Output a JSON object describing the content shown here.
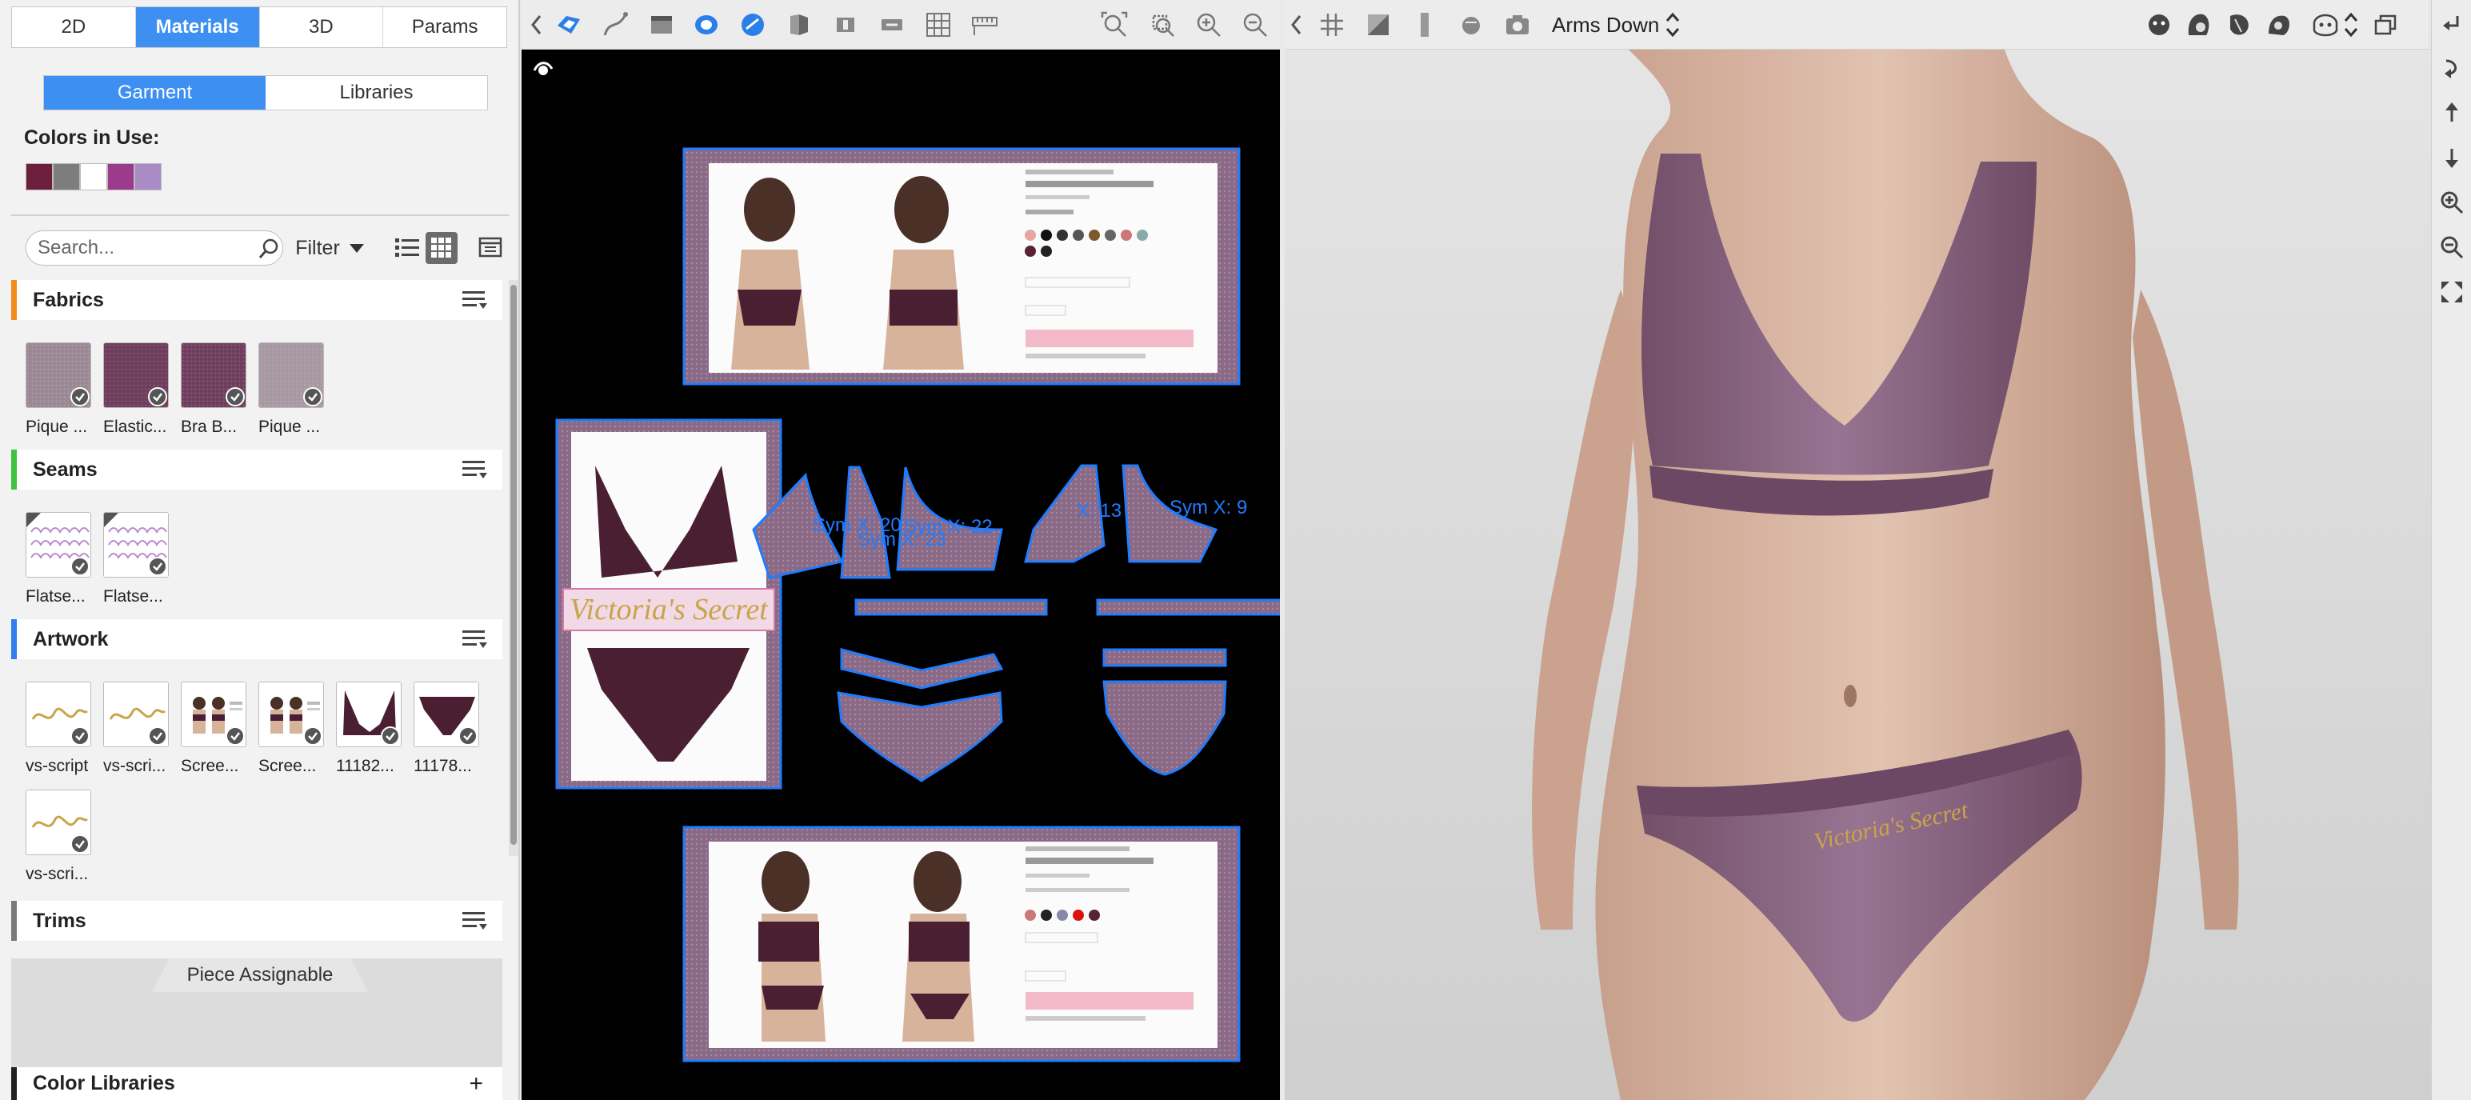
{
  "mode_tabs": [
    {
      "label": "2D",
      "active": false
    },
    {
      "label": "Materials",
      "active": true
    },
    {
      "label": "3D",
      "active": false
    },
    {
      "label": "Params",
      "active": false
    }
  ],
  "sub_tabs": [
    {
      "label": "Garment",
      "active": true
    },
    {
      "label": "Libraries",
      "active": false
    }
  ],
  "colors_in_use": {
    "title": "Colors in Use:",
    "swatches": [
      "#6b1f3d",
      "#7d7d7d",
      "#ffffff",
      "#9c3b8c",
      "#a98bc6"
    ]
  },
  "search": {
    "placeholder": "Search...",
    "value": ""
  },
  "filter": {
    "label": "Filter"
  },
  "sections": {
    "fabrics": {
      "title": "Fabrics",
      "accent": "#f28c1b",
      "items": [
        {
          "label": "Pique ...",
          "swatch": "#9a8994"
        },
        {
          "label": "Elastic...",
          "swatch": "#6e3e5c"
        },
        {
          "label": "Bra B...",
          "swatch": "#6e3e5c"
        },
        {
          "label": "Pique ...",
          "swatch": "#a898a2"
        }
      ]
    },
    "seams": {
      "title": "Seams",
      "accent": "#3ec43e",
      "items": [
        {
          "label": "Flatse..."
        },
        {
          "label": "Flatse..."
        }
      ]
    },
    "artwork": {
      "title": "Artwork",
      "accent": "#2f7fef",
      "items": [
        {
          "label": "vs-script",
          "kind": "script"
        },
        {
          "label": "vs-scri...",
          "kind": "script"
        },
        {
          "label": "Scree...",
          "kind": "photo"
        },
        {
          "label": "Scree...",
          "kind": "photo"
        },
        {
          "label": "11182...",
          "kind": "bra"
        },
        {
          "label": "11178...",
          "kind": "panty"
        },
        {
          "label": "vs-scri...",
          "kind": "script"
        }
      ]
    },
    "trims": {
      "title": "Trims",
      "accent": "#7a7a7a"
    }
  },
  "piece_assignable": {
    "label": "Piece Assignable"
  },
  "color_libraries": {
    "title": "Color Libraries",
    "add": "+"
  },
  "canvas_2d": {
    "brand_text": "Victoria's Secret",
    "labels": [
      "Sym X: 20",
      "Sym X: 22",
      "Sym X: 23",
      "X: 13",
      "Sym X: 9"
    ]
  },
  "toolbar_3d": {
    "pose": "Arms Down"
  },
  "colors": {
    "accent": "#3d8ff2",
    "piece_outline": "#1f7cff",
    "fabric": "#8a6a86",
    "garment": "#6b3a4c"
  }
}
